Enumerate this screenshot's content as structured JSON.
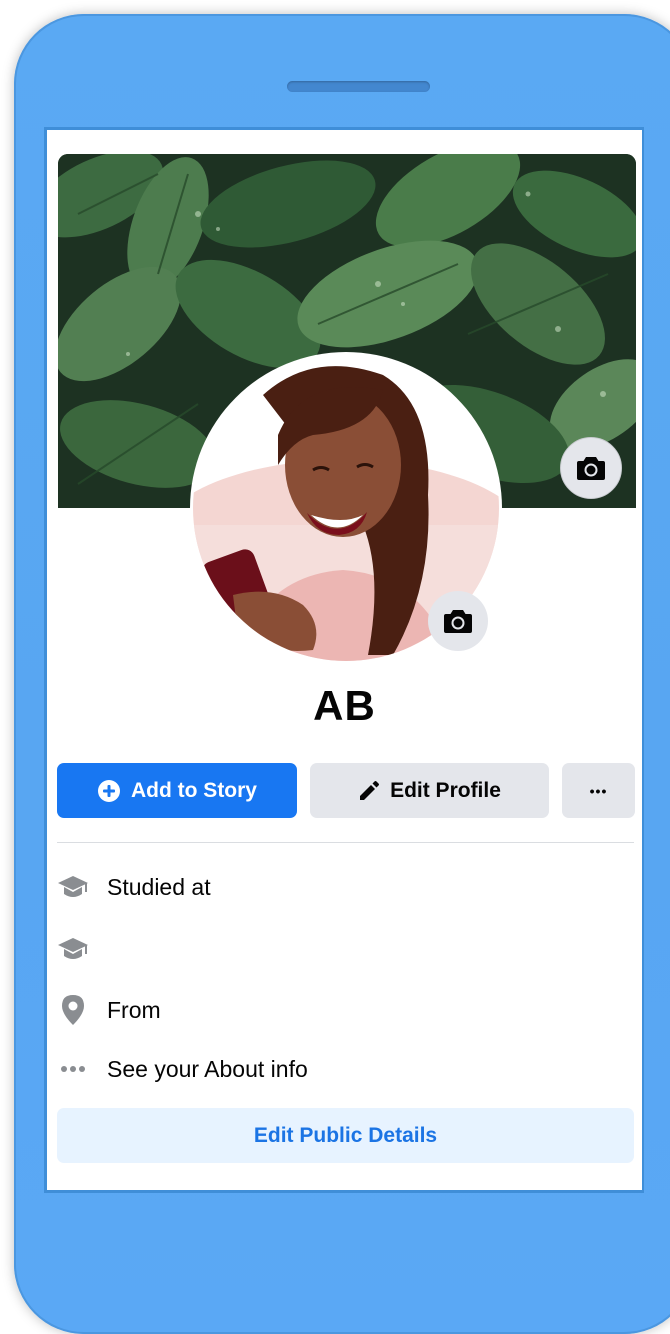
{
  "profile": {
    "name": "AB"
  },
  "actions": {
    "add_story_label": "Add to Story",
    "edit_profile_label": "Edit Profile",
    "more_label": "•••"
  },
  "intro": {
    "studied_label": "Studied at",
    "second_education_label": "",
    "from_label": "From",
    "about_label": "See your About info",
    "edit_public_label": "Edit Public Details"
  },
  "icons": {
    "cover_camera": "camera-icon",
    "avatar_camera": "camera-icon",
    "add_story": "plus-circle-icon",
    "edit_profile": "pencil-icon",
    "studied": "graduation-cap-icon",
    "second_education": "graduation-cap-icon",
    "from": "location-pin-icon",
    "about": "dots-icon"
  },
  "colors": {
    "primary": "#1877f2",
    "secondary_button": "#e4e6eb",
    "public_button_bg": "#e7f3ff",
    "public_button_text": "#1b74e4",
    "phone_frame": "#58a6f2"
  }
}
